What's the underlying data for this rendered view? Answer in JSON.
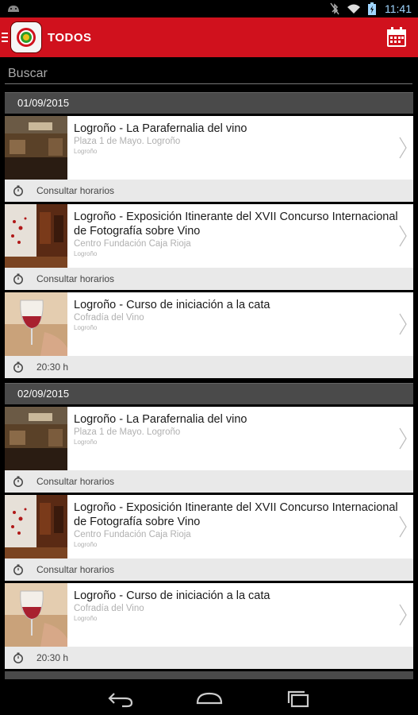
{
  "status_bar": {
    "time": "11:41"
  },
  "app_bar": {
    "title": "TODOS"
  },
  "search": {
    "placeholder": "Buscar"
  },
  "sections": [
    {
      "date": "01/09/2015",
      "events": [
        {
          "title": "Logroño - La Parafernalia del vino",
          "place": "Plaza 1 de Mayo. Logroño",
          "city": "Logroño",
          "schedule": "Consultar horarios",
          "thumb": "cellar"
        },
        {
          "title": "Logroño - Exposición Itinerante del XVII Concurso Internacional de Fotografía sobre Vino",
          "place": "Centro Fundación Caja Rioja",
          "city": "Logroño",
          "schedule": "Consultar horarios",
          "thumb": "exhibit"
        },
        {
          "title": "Logroño - Curso de iniciación a la cata",
          "place": "Cofradía del Vino",
          "city": "Logroño",
          "schedule": "20:30 h",
          "thumb": "glass"
        }
      ]
    },
    {
      "date": "02/09/2015",
      "events": [
        {
          "title": "Logroño - La Parafernalia del vino",
          "place": "Plaza 1 de Mayo. Logroño",
          "city": "Logroño",
          "schedule": "Consultar horarios",
          "thumb": "cellar"
        },
        {
          "title": "Logroño - Exposición Itinerante del XVII Concurso Internacional de Fotografía sobre Vino",
          "place": "Centro Fundación Caja Rioja",
          "city": "Logroño",
          "schedule": "Consultar horarios",
          "thumb": "exhibit"
        },
        {
          "title": "Logroño - Curso de iniciación a la cata",
          "place": "Cofradía del Vino",
          "city": "Logroño",
          "schedule": "20:30 h",
          "thumb": "glass"
        }
      ]
    }
  ],
  "colors": {
    "app_bar": "#d0111d",
    "date_header": "#4a4a4a",
    "card_footer": "#e9e9e9"
  },
  "icons": [
    "menu-icon",
    "app-logo-icon",
    "calendar-icon",
    "clock-icon",
    "chevron-right-icon",
    "back-icon",
    "home-icon",
    "recents-icon"
  ]
}
